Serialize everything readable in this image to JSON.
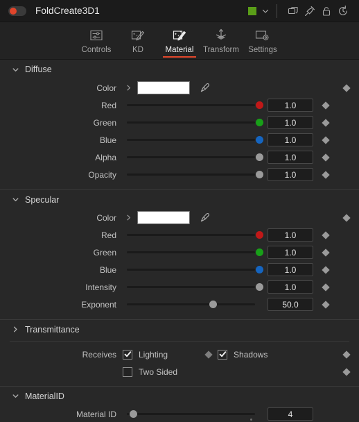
{
  "titlebar": {
    "node_name": "FoldCreate3D1",
    "enable_toggle": "enable-toggle",
    "color_chip": "#5a9e18",
    "accent": "#e2472c",
    "icons": [
      "chevron-down-icon",
      "duplicate-icon",
      "pin-icon",
      "lock-icon",
      "reset-icon"
    ]
  },
  "tabs": [
    {
      "label": "Controls",
      "icon": "controls-icon",
      "active": false
    },
    {
      "label": "KD",
      "icon": "kd-icon",
      "active": false
    },
    {
      "label": "Material",
      "icon": "material-icon",
      "active": true
    },
    {
      "label": "Transform",
      "icon": "transform-icon",
      "active": false
    },
    {
      "label": "Settings",
      "icon": "settings-icon",
      "active": false
    }
  ],
  "groups": [
    {
      "title": "Diffuse",
      "expanded": true,
      "rows": [
        {
          "type": "color",
          "label": "Color",
          "value": "#ffffff",
          "keyframe": true
        },
        {
          "type": "slider",
          "label": "Red",
          "value": "1.0",
          "pct": 100,
          "thumb_color": "#c01818",
          "keyframe": true
        },
        {
          "type": "slider",
          "label": "Green",
          "value": "1.0",
          "pct": 100,
          "thumb_color": "#18a018",
          "keyframe": true
        },
        {
          "type": "slider",
          "label": "Blue",
          "value": "1.0",
          "pct": 100,
          "thumb_color": "#1565c0",
          "keyframe": true
        },
        {
          "type": "slider",
          "label": "Alpha",
          "value": "1.0",
          "pct": 100,
          "thumb_color": "#9a9a9a",
          "keyframe": true
        },
        {
          "type": "slider",
          "label": "Opacity",
          "value": "1.0",
          "pct": 100,
          "thumb_color": "#9a9a9a",
          "keyframe": true
        }
      ]
    },
    {
      "title": "Specular",
      "expanded": true,
      "rows": [
        {
          "type": "color",
          "label": "Color",
          "value": "#ffffff",
          "keyframe": true
        },
        {
          "type": "slider",
          "label": "Red",
          "value": "1.0",
          "pct": 100,
          "thumb_color": "#c01818",
          "keyframe": true
        },
        {
          "type": "slider",
          "label": "Green",
          "value": "1.0",
          "pct": 100,
          "thumb_color": "#18a018",
          "keyframe": true
        },
        {
          "type": "slider",
          "label": "Blue",
          "value": "1.0",
          "pct": 100,
          "thumb_color": "#1565c0",
          "keyframe": true
        },
        {
          "type": "slider",
          "label": "Intensity",
          "value": "1.0",
          "pct": 100,
          "thumb_color": "#9a9a9a",
          "keyframe": true
        },
        {
          "type": "slider",
          "label": "Exponent",
          "value": "50.0",
          "pct": 66,
          "thumb_color": "#9a9a9a",
          "keyframe": true
        }
      ]
    },
    {
      "title": "Transmittance",
      "expanded": false,
      "rows": []
    }
  ],
  "receives": {
    "label": "Receives",
    "checkboxes": [
      {
        "label": "Lighting",
        "checked": true,
        "keyframe": true
      },
      {
        "label": "Shadows",
        "checked": true,
        "keyframe": true
      },
      {
        "label": "Two Sided",
        "checked": false,
        "keyframe": true
      }
    ]
  },
  "material_id": {
    "title": "MaterialID",
    "expanded": true,
    "row": {
      "label": "Material ID",
      "value": "4",
      "pct": 8,
      "thumb_color": "#9a9a9a",
      "has_minidot": true
    }
  }
}
